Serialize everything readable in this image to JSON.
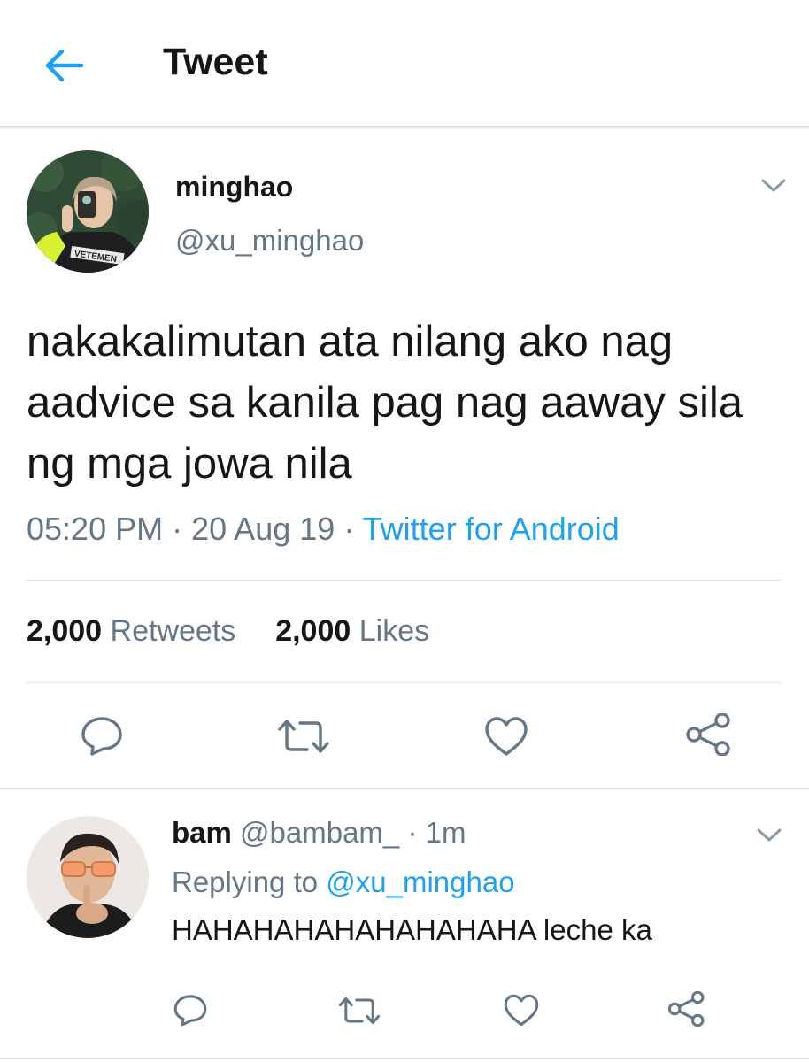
{
  "header": {
    "title": "Tweet",
    "back_icon": "arrow-left-icon",
    "accent": "#1da1f2"
  },
  "tweet": {
    "author_name": "minghao",
    "author_handle": "@xu_minghao",
    "avatar_shirt_text": "VETEMEN",
    "text": "nakakalimutan ata nilang ako nag aadvice sa kanila pag nag aaway sila ng mga jowa nila",
    "time": "05:20 PM",
    "separator": "·",
    "date": "20 Aug 19",
    "source": "Twitter for Android",
    "retweets_count": "2,000",
    "retweets_label": "Retweets",
    "likes_count": "2,000",
    "likes_label": "Likes",
    "actions": [
      "reply-icon",
      "retweet-icon",
      "like-icon",
      "share-icon"
    ]
  },
  "reply": {
    "author_name": "bam",
    "author_handle": "@bambam_",
    "separator": "·",
    "time": "1m",
    "replying_label": "Replying to",
    "replying_handle": "@xu_minghao",
    "text": "HAHAHAHAHAHAHAHAHA leche ka",
    "actions": [
      "reply-icon",
      "retweet-icon",
      "like-icon",
      "share-icon"
    ]
  }
}
